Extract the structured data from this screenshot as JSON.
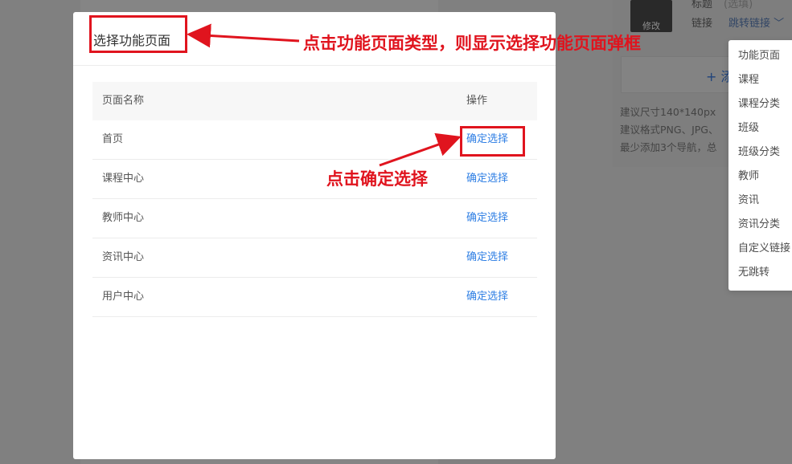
{
  "background": {
    "editor": {
      "field_label_top": "标题",
      "field_value_top": "(选填)",
      "link_label": "链接",
      "link_value": "跳转链接",
      "thumb_label": "修改",
      "add_partial": "+ 添",
      "hints": [
        "建议尺寸140*140px",
        "建议格式PNG、JPG、",
        "最少添加3个导航，总"
      ]
    }
  },
  "dropdown": {
    "items": [
      "功能页面",
      "课程",
      "课程分类",
      "班级",
      "班级分类",
      "教师",
      "资讯",
      "资讯分类",
      "自定义链接",
      "无跳转"
    ]
  },
  "dialog": {
    "title": "选择功能页面",
    "columns": {
      "name": "页面名称",
      "op": "操作"
    },
    "rows": [
      {
        "name": "首页",
        "action": "确定选择"
      },
      {
        "name": "课程中心",
        "action": "确定选择"
      },
      {
        "name": "教师中心",
        "action": "确定选择"
      },
      {
        "name": "资讯中心",
        "action": "确定选择"
      },
      {
        "name": "用户中心",
        "action": "确定选择"
      }
    ]
  },
  "annotations": {
    "title_note": "点击功能页面类型，则显示选择功能页面弹框",
    "select_note": "点击确定选择"
  },
  "colors": {
    "annotation": "#e0141e",
    "link": "#2f7fe4"
  }
}
